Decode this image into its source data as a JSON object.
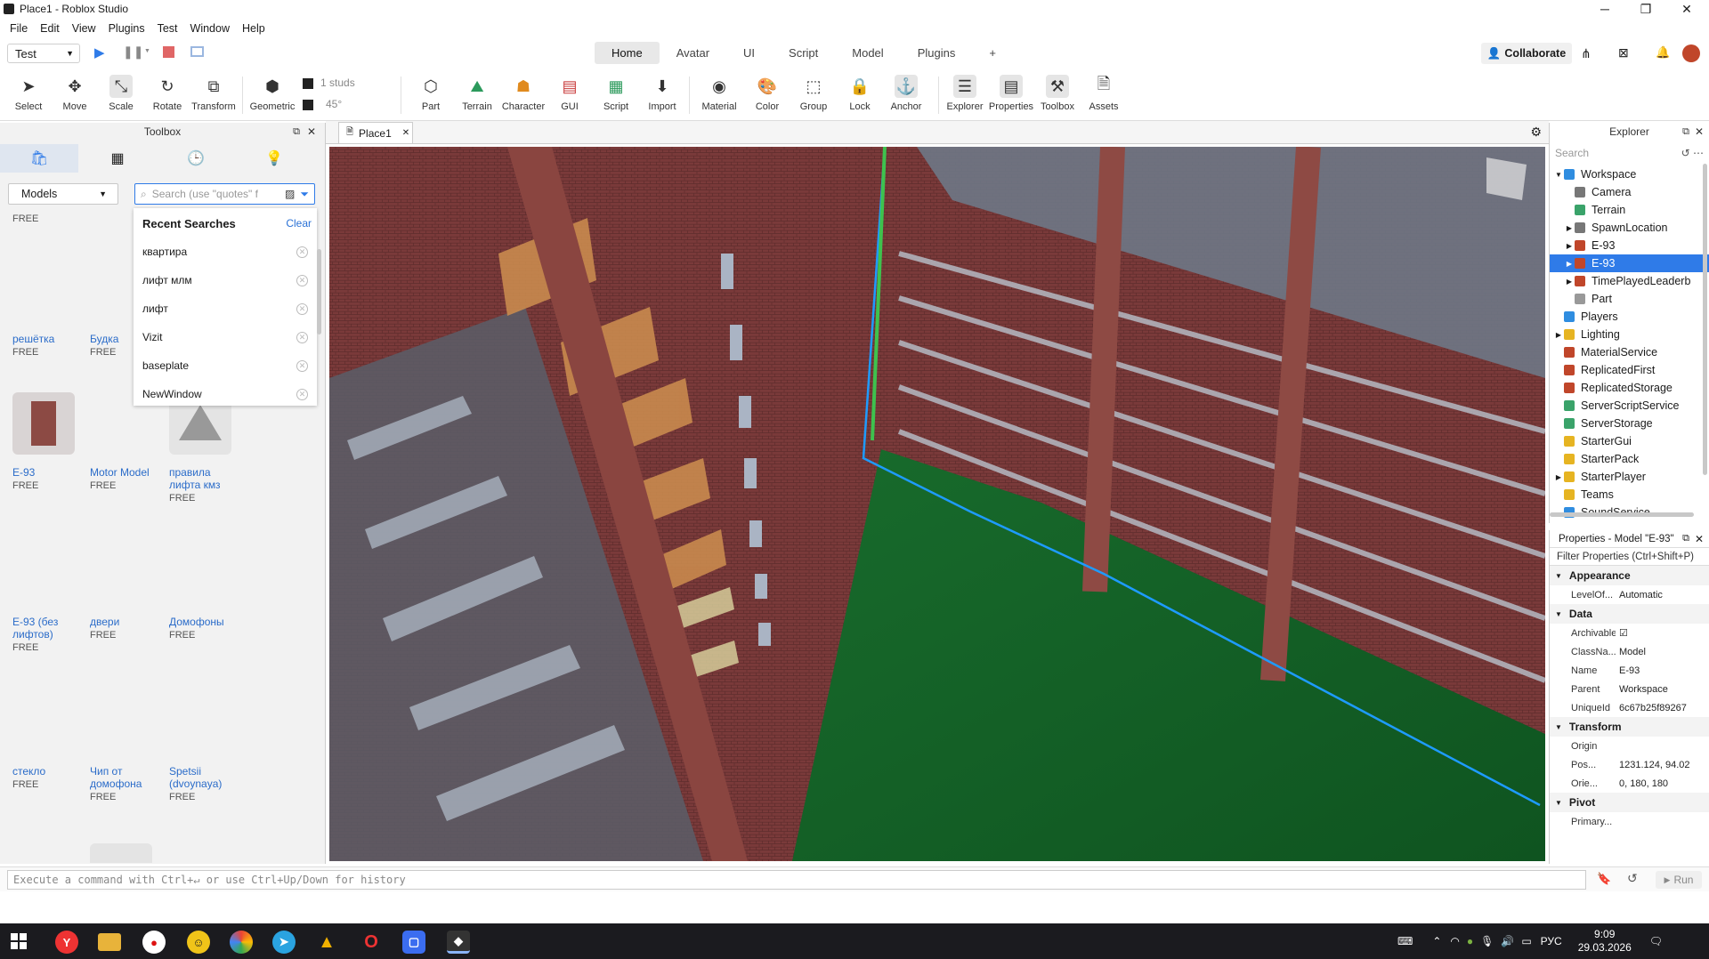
{
  "window": {
    "title": "Place1 - Roblox Studio"
  },
  "menu": [
    "File",
    "Edit",
    "View",
    "Plugins",
    "Test",
    "Window",
    "Help"
  ],
  "test_mode": "Test",
  "ribbon_tabs": [
    "Home",
    "Avatar",
    "UI",
    "Script",
    "Model",
    "Plugins",
    "+"
  ],
  "active_tab": "Home",
  "collaborate": "Collaborate",
  "tools": {
    "select": "Select",
    "move": "Move",
    "scale": "Scale",
    "rotate": "Rotate",
    "transform": "Transform",
    "geometric": "Geometric",
    "studs": "1 studs",
    "degrees": "45°",
    "part": "Part",
    "terrain": "Terrain",
    "character": "Character",
    "gui": "GUI",
    "script": "Script",
    "import": "Import",
    "material": "Material",
    "color": "Color",
    "group": "Group",
    "lock": "Lock",
    "anchor": "Anchor",
    "explorer": "Explorer",
    "properties": "Properties",
    "toolbox": "Toolbox",
    "assets": "Assets"
  },
  "toolbox": {
    "title": "Toolbox",
    "category": "Models",
    "search_placeholder": "Search (use \"quotes\" f",
    "recent_title": "Recent Searches",
    "clear": "Clear",
    "recent": [
      "квартира",
      "лифт млм",
      "лифт",
      "Vizit",
      "baseplate",
      "NewWindow"
    ],
    "assets": [
      {
        "name": "",
        "price": "FREE"
      },
      {
        "name": "решётка",
        "price": "FREE"
      },
      {
        "name": "Будка",
        "price": "FREE"
      },
      {
        "name": "E-93",
        "price": "FREE"
      },
      {
        "name": "Motor Model",
        "price": "FREE"
      },
      {
        "name": "правила лифта кмз",
        "price": "FREE"
      },
      {
        "name": "E-93 (без лифтов)",
        "price": "FREE"
      },
      {
        "name": "двери",
        "price": "FREE"
      },
      {
        "name": "Домофоны",
        "price": "FREE"
      },
      {
        "name": "стекло",
        "price": "FREE"
      },
      {
        "name": "Чип от домофона",
        "price": "FREE"
      },
      {
        "name": "Spetsii (dvoynaya)",
        "price": "FREE"
      }
    ]
  },
  "viewport_tab": "Place1",
  "explorer": {
    "title": "Explorer",
    "search": "Search",
    "items": [
      {
        "label": "Workspace",
        "depth": 0,
        "arrow": "▼",
        "color": "#2f8de0"
      },
      {
        "label": "Camera",
        "depth": 1,
        "arrow": "",
        "color": "#777"
      },
      {
        "label": "Terrain",
        "depth": 1,
        "arrow": "",
        "color": "#3aa36a"
      },
      {
        "label": "SpawnLocation",
        "depth": 1,
        "arrow": "▶",
        "color": "#777"
      },
      {
        "label": "E-93",
        "depth": 1,
        "arrow": "▶",
        "color": "#c0462a"
      },
      {
        "label": "E-93",
        "depth": 1,
        "arrow": "▶",
        "color": "#c0462a",
        "selected": true
      },
      {
        "label": "TimePlayedLeaderb",
        "depth": 1,
        "arrow": "▶",
        "color": "#c0462a"
      },
      {
        "label": "Part",
        "depth": 1,
        "arrow": "",
        "color": "#999"
      },
      {
        "label": "Players",
        "depth": 0,
        "arrow": "",
        "color": "#2f8de0"
      },
      {
        "label": "Lighting",
        "depth": 0,
        "arrow": "▶",
        "color": "#e6b422"
      },
      {
        "label": "MaterialService",
        "depth": 0,
        "arrow": "",
        "color": "#c0462a"
      },
      {
        "label": "ReplicatedFirst",
        "depth": 0,
        "arrow": "",
        "color": "#c0462a"
      },
      {
        "label": "ReplicatedStorage",
        "depth": 0,
        "arrow": "",
        "color": "#c0462a"
      },
      {
        "label": "ServerScriptService",
        "depth": 0,
        "arrow": "",
        "color": "#3aa36a"
      },
      {
        "label": "ServerStorage",
        "depth": 0,
        "arrow": "",
        "color": "#3aa36a"
      },
      {
        "label": "StarterGui",
        "depth": 0,
        "arrow": "",
        "color": "#e6b422"
      },
      {
        "label": "StarterPack",
        "depth": 0,
        "arrow": "",
        "color": "#e6b422"
      },
      {
        "label": "StarterPlayer",
        "depth": 0,
        "arrow": "▶",
        "color": "#e6b422"
      },
      {
        "label": "Teams",
        "depth": 0,
        "arrow": "",
        "color": "#e6b422"
      },
      {
        "label": "SoundService",
        "depth": 0,
        "arrow": "",
        "color": "#2f8de0"
      }
    ]
  },
  "properties": {
    "title": "Properties - Model \"E-93\"",
    "filter": "Filter Properties (Ctrl+Shift+P)",
    "sections": [
      {
        "name": "Appearance",
        "rows": [
          {
            "k": "LevelOf...",
            "v": "Automatic"
          }
        ]
      },
      {
        "name": "Data",
        "rows": [
          {
            "k": "Archivable",
            "v": "☑"
          },
          {
            "k": "ClassNa...",
            "v": "Model"
          },
          {
            "k": "Name",
            "v": "E-93"
          },
          {
            "k": "Parent",
            "v": "Workspace"
          },
          {
            "k": "UniqueId",
            "v": "6c67b25f89267"
          }
        ]
      },
      {
        "name": "Transform",
        "rows": [
          {
            "k": "Origin",
            "v": ""
          },
          {
            "k": "Pos...",
            "v": "1231.124, 94.02"
          },
          {
            "k": "Orie...",
            "v": "0, 180, 180"
          }
        ]
      },
      {
        "name": "Pivot",
        "rows": [
          {
            "k": "Primary...",
            "v": ""
          }
        ]
      }
    ]
  },
  "command": {
    "placeholder": "Execute a command with Ctrl+↵ or use Ctrl+Up/Down for history",
    "run": "Run"
  },
  "taskbar": {
    "lang": "РУС",
    "time": "9:09",
    "date": "29.03.2026"
  }
}
